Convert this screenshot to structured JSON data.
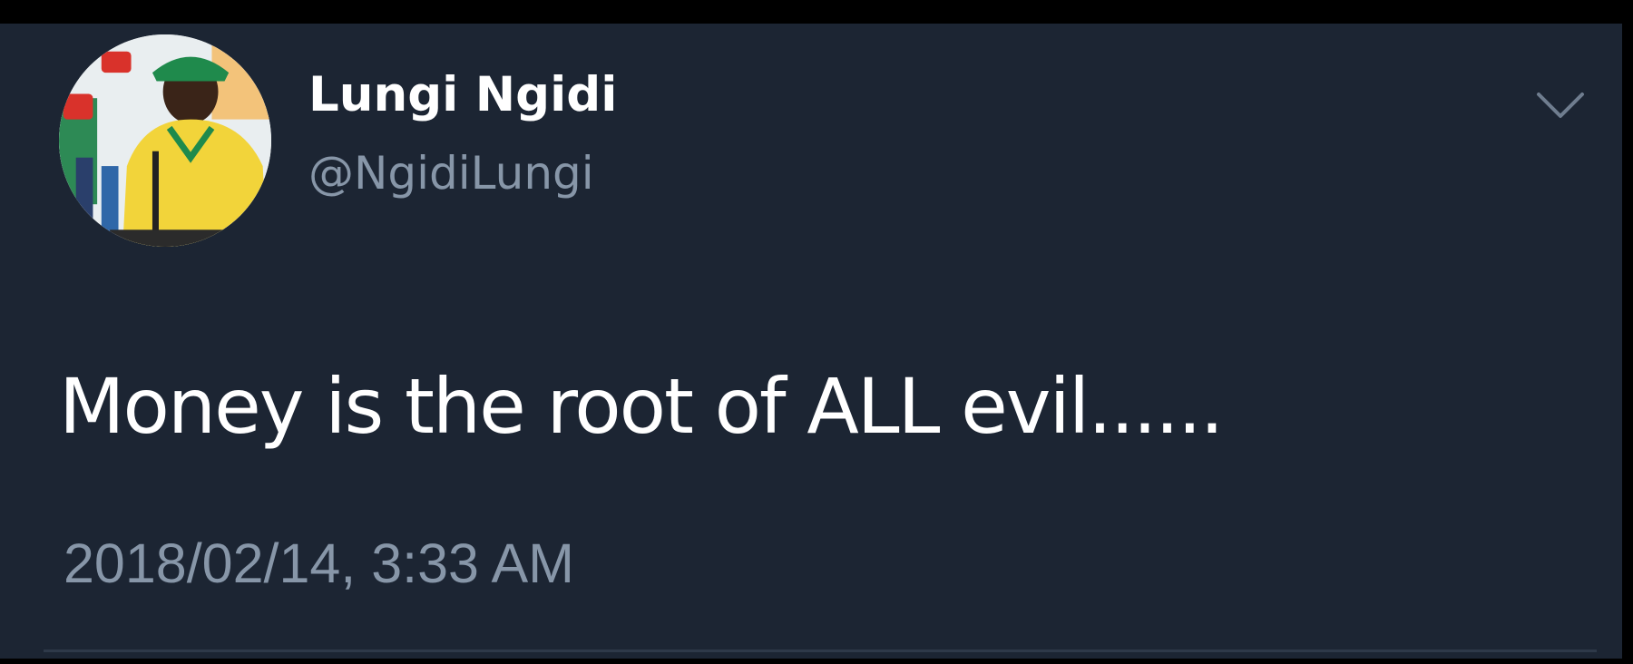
{
  "tweet": {
    "author": {
      "display_name": "Lungi Ngidi",
      "handle": "@NgidiLungi",
      "avatar_icon": "profile-photo"
    },
    "text": "Money is the root of ALL evil......",
    "timestamp": "2018/02/14, 3:33 AM",
    "menu_icon": "chevron-down-icon"
  },
  "colors": {
    "card_background": "#1c2533",
    "primary_text": "#ffffff",
    "secondary_text": "#8796a8",
    "frame": "#000000"
  }
}
